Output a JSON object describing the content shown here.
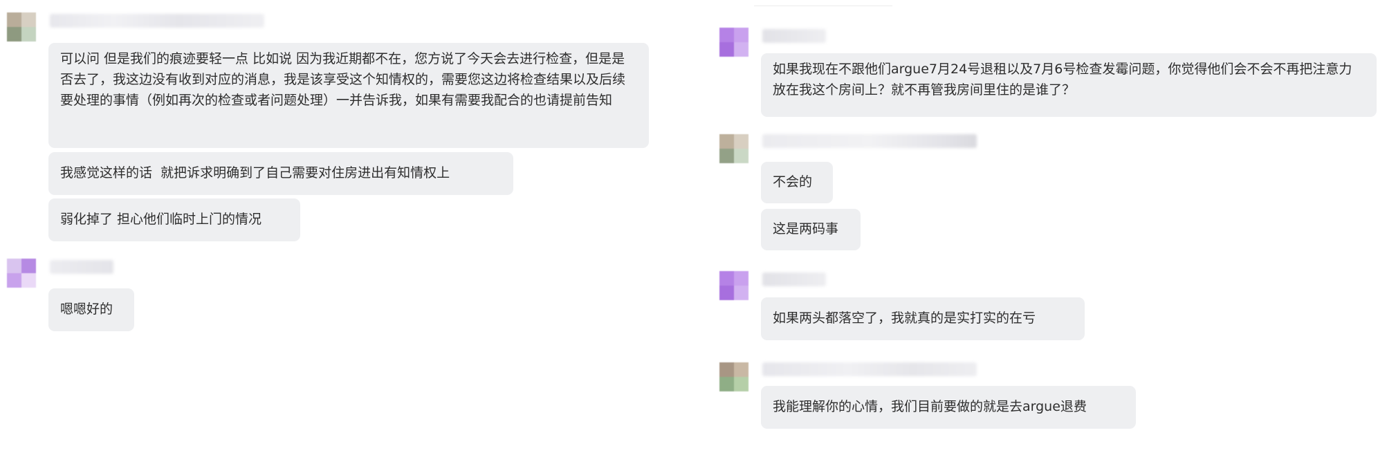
{
  "left_chat": {
    "messages": [
      {
        "sender": "other",
        "avatar_colors": [
          "#b9ad9a",
          "#d7cfc2",
          "#8e9a80",
          "#c4d4c0"
        ],
        "bubbles": [
          "可以问 但是我们的痕迹要轻一点 比如说 因为我近期都不在，您方说了今天会去进行检查，但是是否去了，我这边没有收到对应的消息，我是该享受这个知情权的，需要您这边将检查结果以及后续要处理的事情（例如再次的检查或者问题处理）一并告诉我，如果有需要我配合的也请提前告知",
          "我感觉这样的话  就把诉求明确到了自己需要对住房进出有知情权上",
          "弱化掉了 担心他们临时上门的情况"
        ]
      },
      {
        "sender": "other",
        "avatar_colors": [
          "#d9c4ef",
          "#b68ae3",
          "#c8a2ec",
          "#ead9f7"
        ],
        "bubbles": [
          "嗯嗯好的"
        ]
      }
    ]
  },
  "right_chat": {
    "messages": [
      {
        "sender": "other",
        "avatar_colors": [
          "#b582e6",
          "#c9a1ee",
          "#a76fde",
          "#d2b2f1"
        ],
        "bubbles": [
          "如果我现在不跟他们argue7月24号退租以及7月6号检查发霉问题，你觉得他们会不会不再把注意力放在我这个房间上？就不再管我房间里住的是谁了？"
        ]
      },
      {
        "sender": "other",
        "avatar_colors": [
          "#bdb09c",
          "#d8cfc1",
          "#93a187",
          "#cad8c5"
        ],
        "bubbles": [
          "不会的",
          "这是两码事"
        ]
      },
      {
        "sender": "other",
        "avatar_colors": [
          "#b582e6",
          "#c9a1ee",
          "#a76fde",
          "#d2b2f1"
        ],
        "bubbles": [
          "如果两头都落空了，我就真的是实打实的在亏"
        ]
      },
      {
        "sender": "other",
        "avatar_colors": [
          "#a89684",
          "#c9b8a4",
          "#8fae86",
          "#b5cfa8"
        ],
        "bubbles": [
          "我能理解你的心情，我们目前要做的就是去argue退费"
        ]
      }
    ]
  }
}
